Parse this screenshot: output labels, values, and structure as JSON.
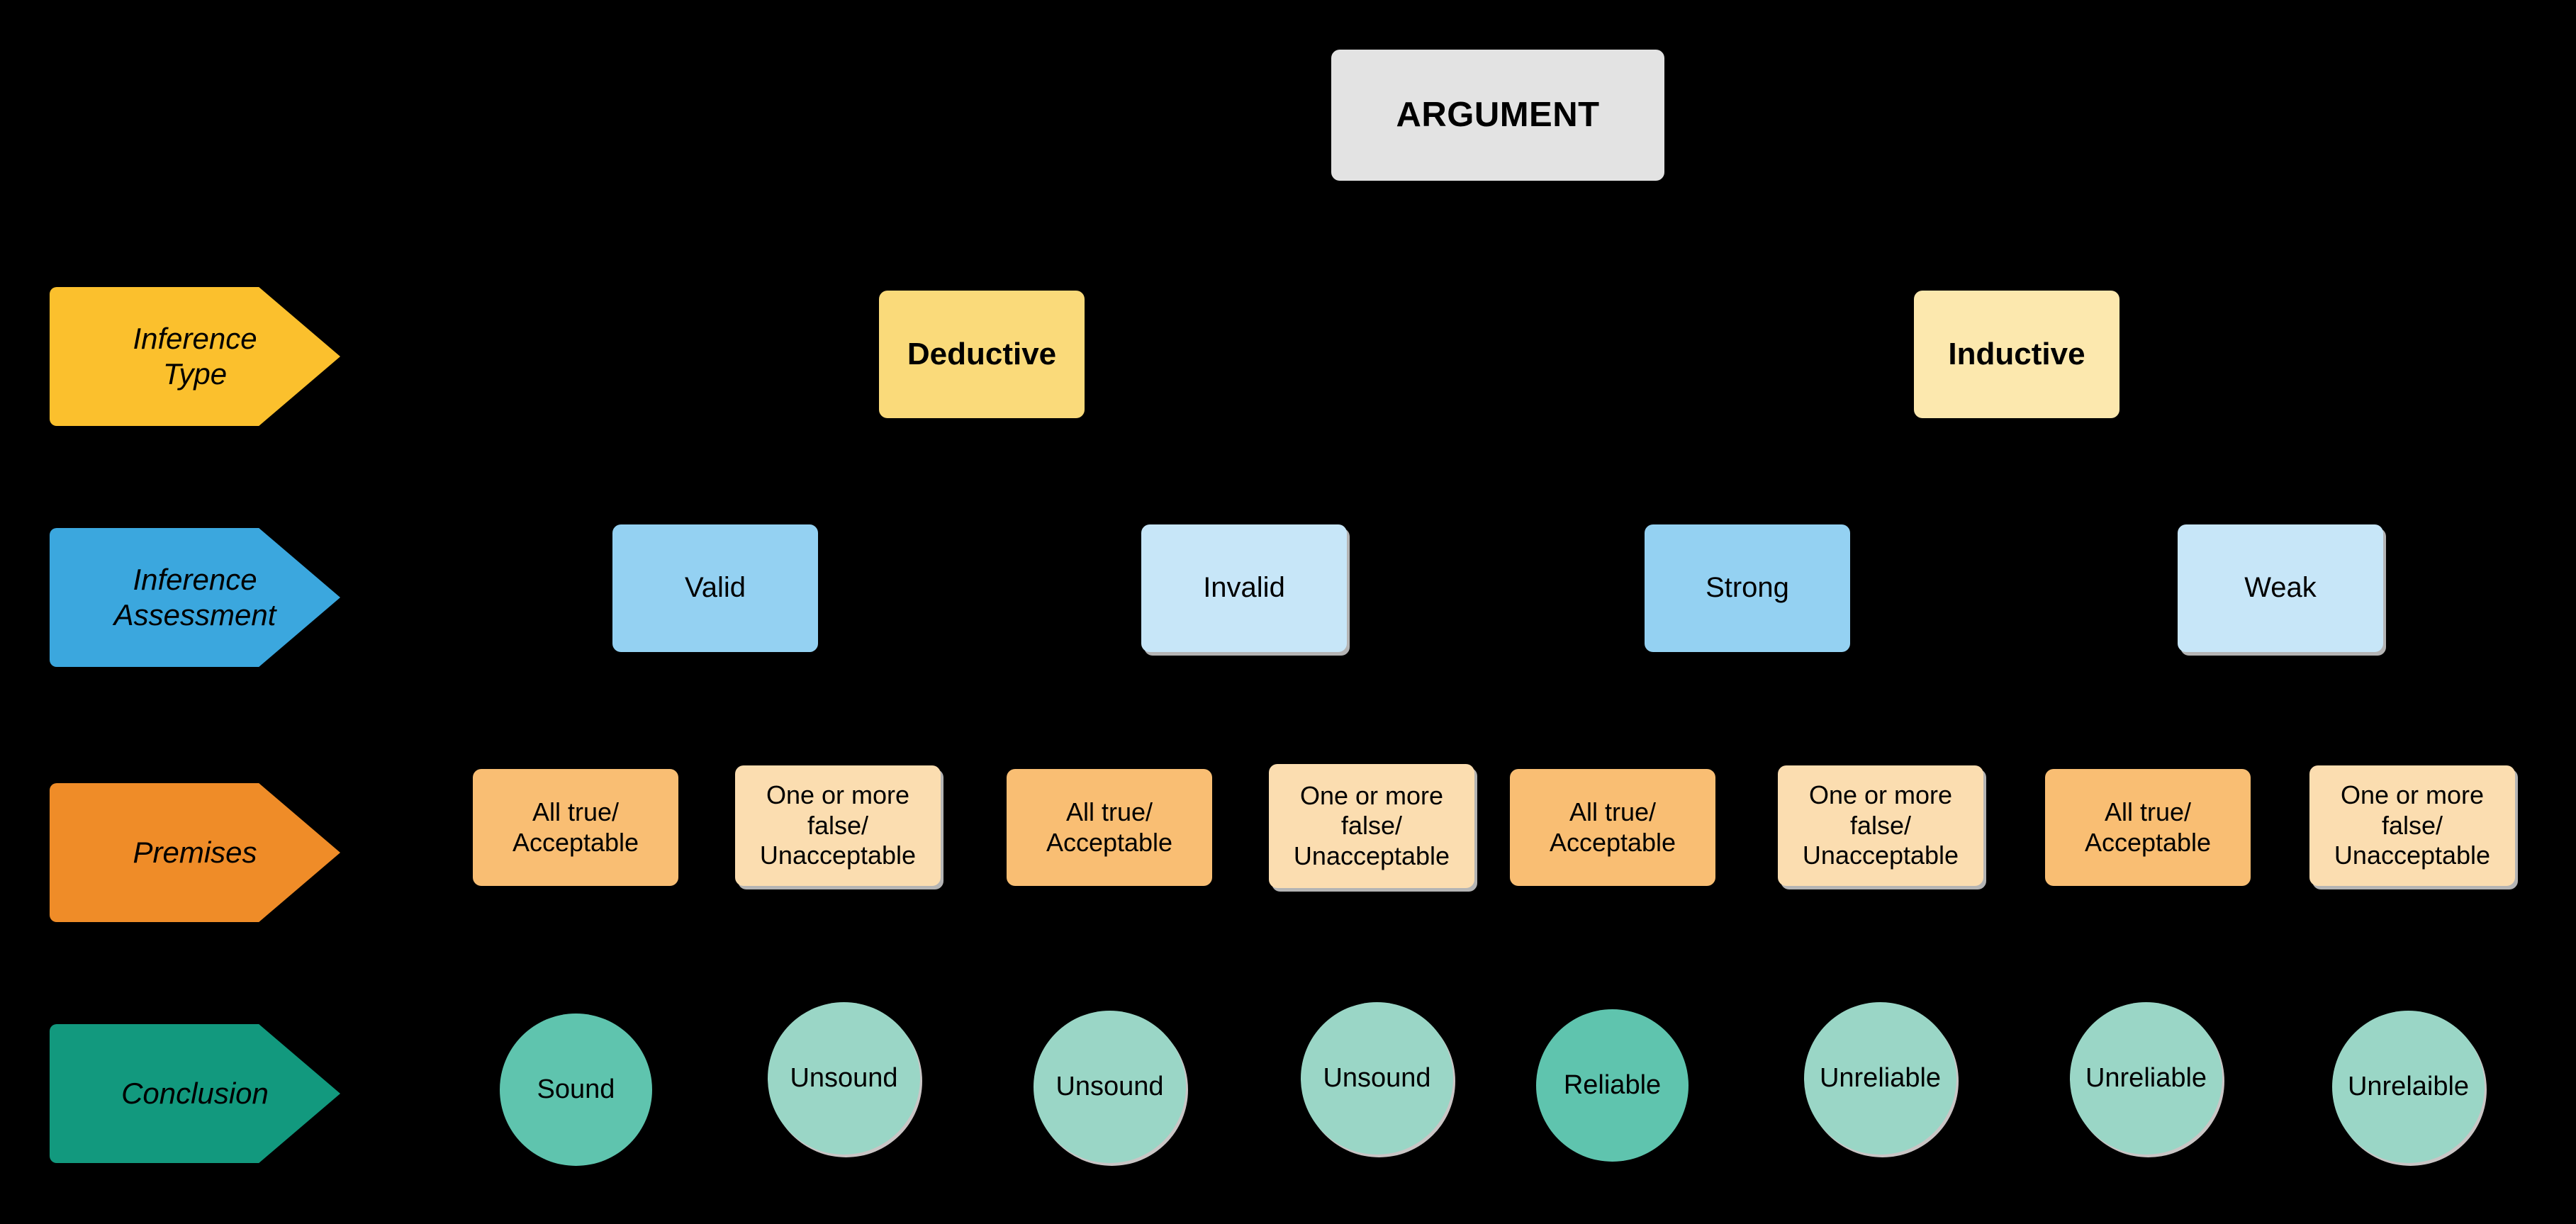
{
  "diagram": {
    "title": "ARGUMENT",
    "root": {
      "label": "ARGUMENT"
    },
    "row_labels": [
      {
        "id": "inference-type",
        "label": "Inference\nType",
        "line1": "Inference",
        "line2": "Type",
        "color": "#FBC02D"
      },
      {
        "id": "inference-assessment",
        "label": "Inference\nAssessment",
        "line1": "Inference",
        "line2": "Assessment",
        "color": "#3BA7DE"
      },
      {
        "id": "premises",
        "label": "Premises",
        "line1": "Premises",
        "line2": "",
        "color": "#EF8C28"
      },
      {
        "id": "conclusion",
        "label": "Conclusion",
        "line1": "Conclusion",
        "line2": "",
        "color": "#12997E"
      }
    ],
    "inference_types": [
      {
        "label": "Deductive",
        "color": "#FADA7A"
      },
      {
        "label": "Inductive",
        "color": "#FCE8AE"
      }
    ],
    "inference_assessments": [
      {
        "label": "Valid",
        "color": "#94D1F2",
        "shadow": false
      },
      {
        "label": "Invalid",
        "color": "#C7E6F8",
        "shadow": true
      },
      {
        "label": "Strong",
        "color": "#94D1F2",
        "shadow": false
      },
      {
        "label": "Weak",
        "color": "#C7E6F8",
        "shadow": true
      }
    ],
    "premises": [
      {
        "line1": "All true/",
        "line2": "Acceptable",
        "line3": "",
        "color": "#F9BE73",
        "shadow": false
      },
      {
        "line1": "One or more",
        "line2": "false/",
        "line3": "Unacceptable",
        "color": "#FBDDB0",
        "shadow": true
      },
      {
        "line1": "All true/",
        "line2": "Acceptable",
        "line3": "",
        "color": "#F9BE73",
        "shadow": false
      },
      {
        "line1": "One or more",
        "line2": "false/",
        "line3": "Unacceptable",
        "color": "#FBDDB0",
        "shadow": true
      },
      {
        "line1": "All true/",
        "line2": "Acceptable",
        "line3": "",
        "color": "#F9BE73",
        "shadow": false
      },
      {
        "line1": "One or more",
        "line2": "false/",
        "line3": "Unacceptable",
        "color": "#FBDDB0",
        "shadow": true
      },
      {
        "line1": "All true/",
        "line2": "Acceptable",
        "line3": "",
        "color": "#F9BE73",
        "shadow": false
      },
      {
        "line1": "One or more",
        "line2": "false/",
        "line3": "Unacceptable",
        "color": "#FBDDB0",
        "shadow": true
      }
    ],
    "conclusions": [
      {
        "label": "Sound",
        "color": "#5FC4AE",
        "shadow": false
      },
      {
        "label": "Unsound",
        "color": "#9AD6C6",
        "shadow": true
      },
      {
        "label": "Unsound",
        "color": "#9AD6C6",
        "shadow": true
      },
      {
        "label": "Unsound",
        "color": "#9AD6C6",
        "shadow": true
      },
      {
        "label": "Reliable",
        "color": "#5FC4AE",
        "shadow": false
      },
      {
        "label": "Unreliable",
        "color": "#9AD6C6",
        "shadow": true
      },
      {
        "label": "Unreliable",
        "color": "#9AD6C6",
        "shadow": true
      },
      {
        "label": "Unrelaible",
        "color": "#9AD6C6",
        "shadow": true
      }
    ],
    "background_color": "#000000"
  }
}
